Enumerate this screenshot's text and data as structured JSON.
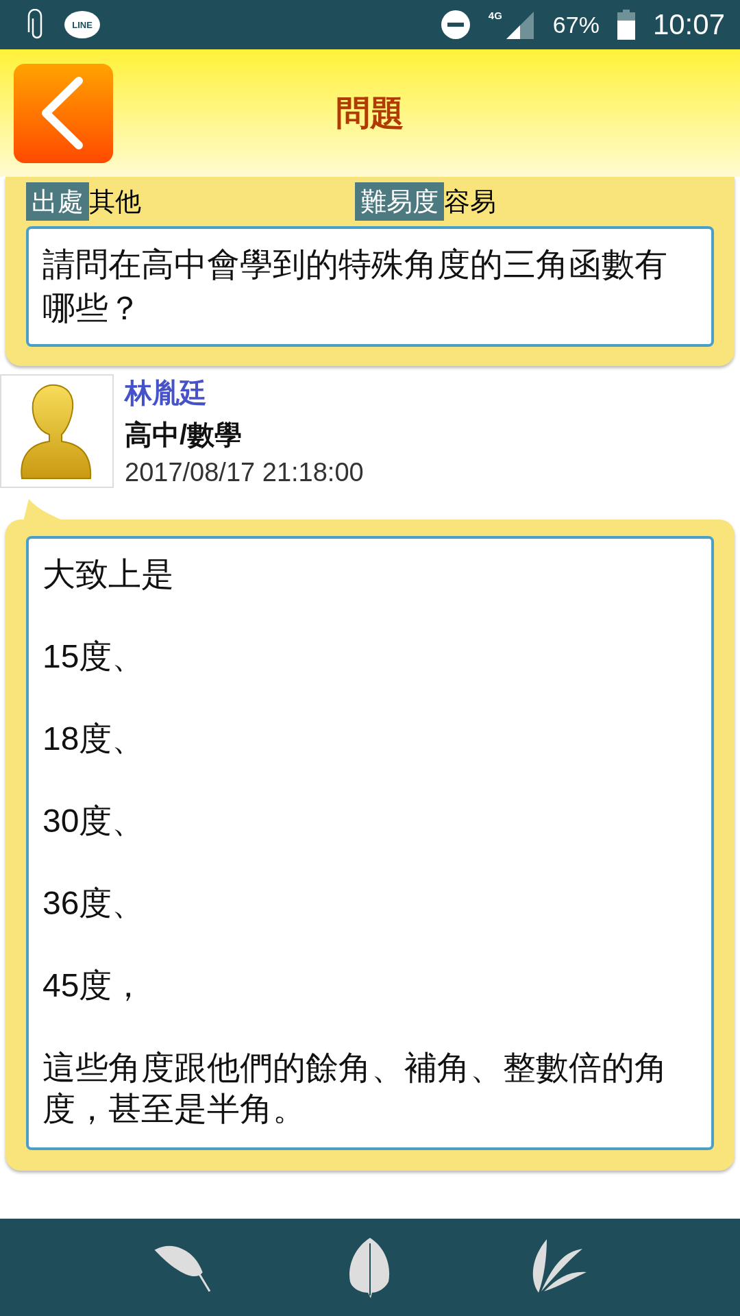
{
  "status_bar": {
    "app_badge": "LINE",
    "network": "4G",
    "battery": "67%",
    "time": "10:07"
  },
  "header": {
    "title": "問題"
  },
  "question": {
    "source_label": "出處",
    "source": "其他",
    "difficulty_label": "難易度",
    "difficulty": "容易",
    "text": "請問在高中會學到的特殊角度的三角函數有哪些？"
  },
  "answer": {
    "author": "林胤廷",
    "subject": "高中/數學",
    "date": "2017/08/17 21:18:00",
    "paragraphs": [
      "大致上是",
      "15度、",
      "18度、",
      "30度、",
      "36度、",
      "45度，",
      "這些角度跟他們的餘角、補角、整數倍的角度，甚至是半角。"
    ]
  }
}
